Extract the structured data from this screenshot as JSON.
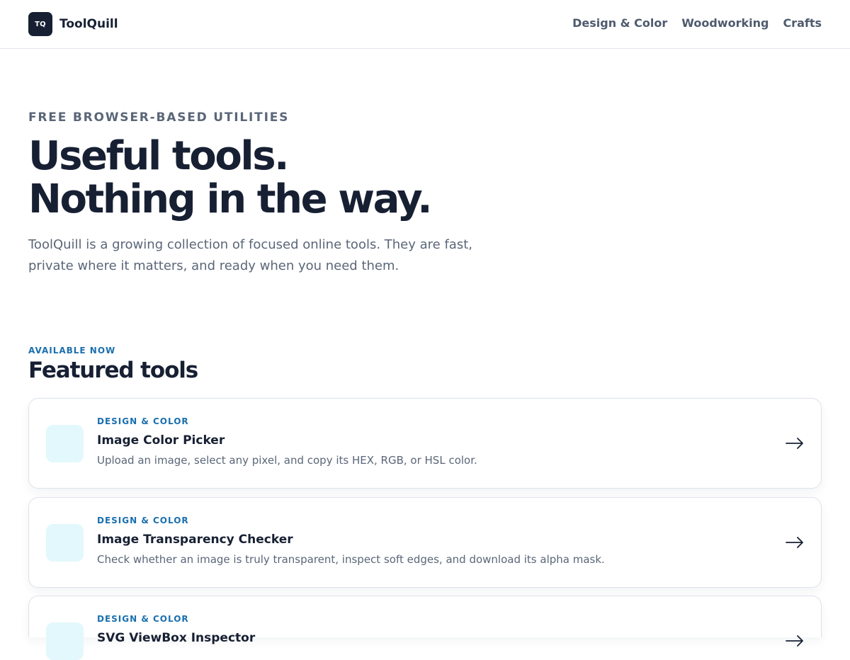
{
  "header": {
    "logo_text": "TQ",
    "brand_name": "ToolQuill",
    "nav": [
      {
        "label": "Design & Color"
      },
      {
        "label": "Woodworking"
      },
      {
        "label": "Crafts"
      }
    ]
  },
  "hero": {
    "eyebrow": "FREE BROWSER-BASED UTILITIES",
    "headline_line1": "Useful tools.",
    "headline_line2": "Nothing in the way.",
    "intro": "ToolQuill is a growing collection of focused online tools. They are fast, private where it matters, and ready when you need them."
  },
  "featured": {
    "kicker": "AVAILABLE NOW",
    "title": "Featured tools",
    "tools": [
      {
        "category": "DESIGN & COLOR",
        "name": "Image Color Picker",
        "description": "Upload an image, select any pixel, and copy its HEX, RGB, or HSL color.",
        "icon": "tool-icon-tile",
        "action_icon": "arrow-right-icon"
      },
      {
        "category": "DESIGN & COLOR",
        "name": "Image Transparency Checker",
        "description": "Check whether an image is truly transparent, inspect soft edges, and download its alpha mask.",
        "icon": "tool-icon-tile",
        "action_icon": "arrow-right-icon"
      },
      {
        "category": "DESIGN & COLOR",
        "name": "SVG ViewBox Inspector",
        "description": "",
        "icon": "tool-icon-tile",
        "action_icon": "arrow-right-icon"
      }
    ]
  },
  "colors": {
    "ink": "#172033",
    "muted": "#5a6678",
    "accent": "#1a6fae",
    "icon_tile": "#e2f8fc",
    "border": "#dde2e9"
  }
}
